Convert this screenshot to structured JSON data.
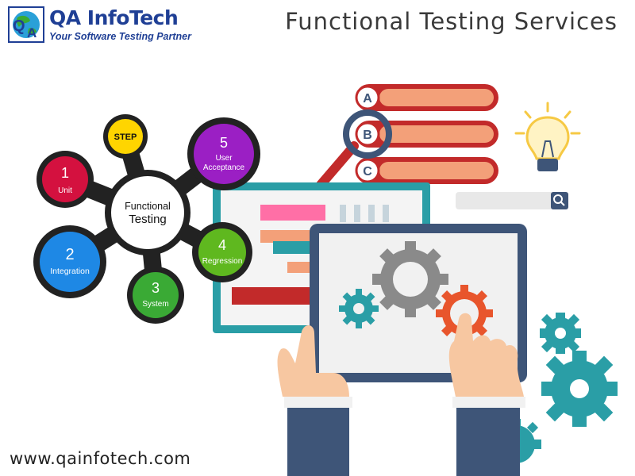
{
  "header": {
    "brand_name": "QA InfoTech",
    "brand_tagline": "Your Software Testing Partner",
    "title": "Functional Testing Services"
  },
  "diagram": {
    "center": {
      "line1": "Functional",
      "line2": "Testing"
    },
    "step_label": "STEP",
    "steps": [
      {
        "number": "1",
        "label": "Unit",
        "color": "#d4113f"
      },
      {
        "number": "2",
        "label": "Integration",
        "color": "#1e88e5"
      },
      {
        "number": "3",
        "label": "System",
        "color": "#3aaa35"
      },
      {
        "number": "4",
        "label": "Regression",
        "color": "#5fb81f"
      },
      {
        "number": "5",
        "label": "User",
        "label2": "Acceptance",
        "color": "#9b1fc4"
      }
    ],
    "step_badge_color": "#ffd500"
  },
  "options": [
    "A",
    "B",
    "C"
  ],
  "footer": {
    "website": "www.qainfotech.com"
  },
  "colors": {
    "navy": "#3e5578",
    "teal": "#2a9ea6",
    "orange": "#e8552c",
    "salmon": "#f3a079",
    "red_dark": "#c22a2a"
  },
  "icons": [
    "lightbulb-icon",
    "search-icon",
    "magnifier-icon",
    "gear-icon",
    "hand-icon"
  ]
}
